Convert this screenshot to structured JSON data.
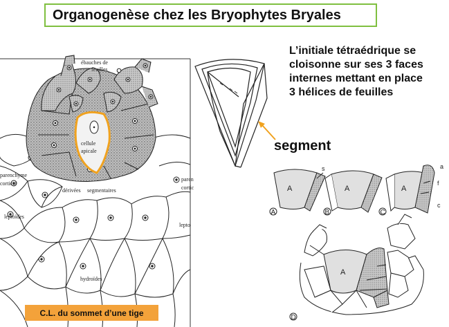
{
  "title": "Organogenèse chez les Bryophytes Bryales",
  "description": {
    "line1": "L’initiale tétraédrique se",
    "line2": "cloisonne sur ses 3 faces",
    "line3": "internes mettant en place",
    "line4": "3 hélices de feuilles"
  },
  "segment_label": "segment",
  "caption": "C.L. du sommet d’une tige",
  "section_labels": {
    "ebauches_1": "ébauches de",
    "ebauches_2": "feuilles",
    "cellule": "cellule",
    "apicale": "apicale",
    "parenchyme_1": "parenchyme",
    "parenchyme_2": "cortical",
    "derivees": "dérivées",
    "segmentaires": "segmentaires",
    "leptoides_left": "leptoïdes",
    "leptoides_right": "lepto",
    "hydroides": "hydroïdes",
    "paren_right_1": "paren",
    "paren_right_2": "cortic"
  },
  "panel_labels": {
    "A_letter": "A",
    "s": "s",
    "a": "a",
    "f": "f",
    "c": "c",
    "panel_A": "A",
    "panel_B": "B",
    "panel_C": "C",
    "panel_D": "D"
  },
  "colors": {
    "title_border": "#7fbf3f",
    "caption_bg": "#f3a23a",
    "apical_outline": "#f0a21f",
    "arrow": "#f0a21f",
    "stipple": "#8a8a8a"
  }
}
